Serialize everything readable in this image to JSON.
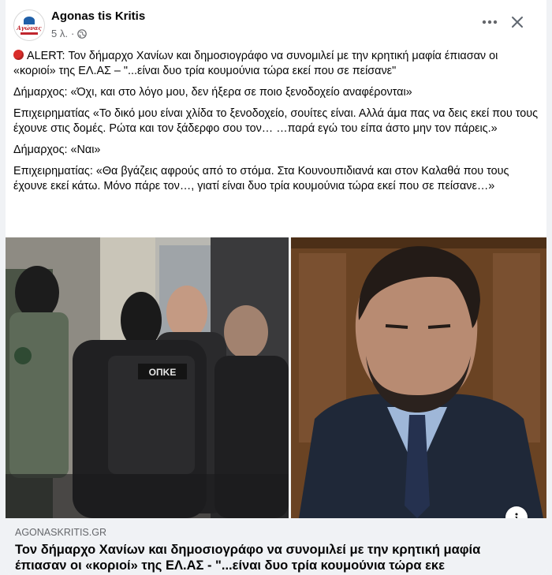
{
  "post": {
    "page_name": "Agonas tis Kritis",
    "time": "5 λ.",
    "separator": "·",
    "avatar_text": "Αγώνας"
  },
  "icons": {
    "more": "more-horizontal-icon",
    "close": "close-icon",
    "privacy": "globe-icon",
    "alert": "red-circle-icon",
    "info": "info-icon"
  },
  "body": {
    "p1": "ALERT: Τον δήμαρχο Χανίων και δημοσιογράφο να συνομιλεί με την κρητική μαφία έπιασαν οι «κοριοί» της ΕΛ.ΑΣ – \"...είναι δυο τρία κουμούνια τώρα εκεί που σε πείσανε\"",
    "p2": "Δήμαρχος: «Όχι, και στο λόγο μου, δεν ήξερα σε ποιο ξενοδοχείο αναφέρονται»",
    "p3": "Επιχειρηματίας «Το δικό μου είναι χλίδα το ξενοδοχείο, σουίτες είναι. Αλλά άμα πας να δεις εκεί που τους έχουνε στις δομές. Ρώτα και τον ξάδερφο σου τον… …παρά εγώ του είπα άστο μην τον πάρεις.»",
    "p4": "Δήμαρχος: «Ναι»",
    "p5": "Επιχειρηματίας: «Θα βγάζεις αφρούς από το στόμα. Στα Κουνουπιδιανά και στον Καλαθά που τους έχουνε εκεί κάτω. Μόνο πάρε τον…, γιατί είναι δυο τρία κουμούνια τώρα εκεί που σε πείσανε…»"
  },
  "image": {
    "vest_label": "ΟΠΚΕ"
  },
  "link": {
    "domain": "AGONASKRITIS.GR",
    "title": "Τον δήμαρχο Χανίων και δημοσιογράφο να συνομιλεί με την κρητική μαφία έπιασαν οι «κοριοί» της ΕΛ.ΑΣ - \"...είναι δυο τρία κουμούνια τώρα εκε"
  },
  "colors": {
    "alert": "#d92d2a",
    "secondary_text": "#65676b",
    "link_bg": "#f0f2f5"
  }
}
